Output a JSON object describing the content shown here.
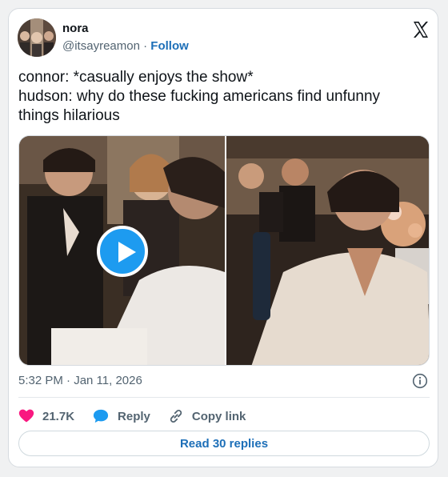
{
  "author": {
    "display_name": "nora",
    "handle": "@itsayreamon",
    "separator": "·",
    "follow_label": "Follow"
  },
  "tweet": {
    "lines": [
      "connor: *casually enjoys the show*",
      "hudson: why do these fucking americans find unfunny",
      "things hilarious"
    ]
  },
  "media": {
    "type": "video",
    "play_icon": "play-icon"
  },
  "timestamp": "5:32 PM · Jan 11, 2026",
  "actions": {
    "like_count": "21.7K",
    "reply_label": "Reply",
    "copy_link_label": "Copy link"
  },
  "read_replies_label": "Read 30 replies",
  "colors": {
    "accent": "#1d9bf0",
    "link": "#1d6fb8",
    "like": "#f91880",
    "text": "#0f1419",
    "muted": "#536471"
  }
}
